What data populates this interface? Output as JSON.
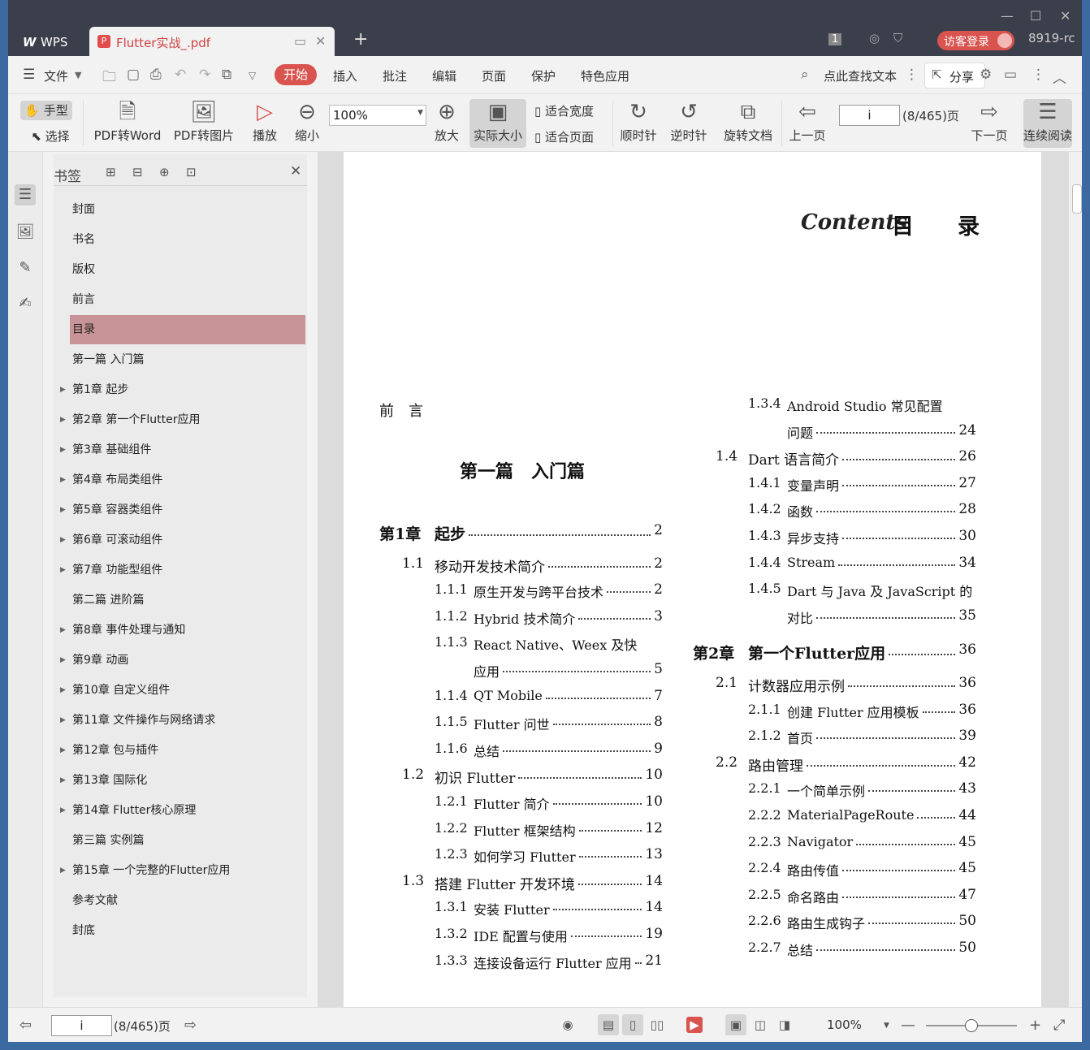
{
  "titlebar": {
    "app_tab": "WPS",
    "doc_tab": "Flutter实战_.pdf",
    "tab_count": "1",
    "login": "访客登录",
    "user_code": "8919-rc"
  },
  "menubar": {
    "file": "文件",
    "tabs": [
      "开始",
      "插入",
      "批注",
      "编辑",
      "页面",
      "保护",
      "特色应用"
    ],
    "search": "点此查找文本",
    "share": "分享"
  },
  "toolbar": {
    "hand": "手型",
    "select": "选择",
    "pdf2word": "PDF转Word",
    "pdf2img": "PDF转图片",
    "play": "播放",
    "zoom_out": "缩小",
    "zoom_value": "100%",
    "zoom_in": "放大",
    "actual_size": "实际大小",
    "fit_width": "适合宽度",
    "fit_page": "适合页面",
    "clockwise": "顺时针",
    "counter": "逆时针",
    "rotate": "旋转文档",
    "prev": "上一页",
    "page_value": "i",
    "page_total": "(8/465)页",
    "next": "下一页",
    "continuous": "连续阅读"
  },
  "bookmarks": {
    "title": "书签",
    "items": [
      {
        "label": "封面",
        "arrow": false
      },
      {
        "label": "书名",
        "arrow": false
      },
      {
        "label": "版权",
        "arrow": false
      },
      {
        "label": "前言",
        "arrow": false
      },
      {
        "label": "目录",
        "arrow": false,
        "active": true
      },
      {
        "label": "第一篇 入门篇",
        "arrow": false
      },
      {
        "label": "第1章 起步",
        "arrow": true
      },
      {
        "label": "第2章 第一个Flutter应用",
        "arrow": true
      },
      {
        "label": "第3章 基础组件",
        "arrow": true
      },
      {
        "label": "第4章 布局类组件",
        "arrow": true
      },
      {
        "label": "第5章 容器类组件",
        "arrow": true
      },
      {
        "label": "第6章 可滚动组件",
        "arrow": true
      },
      {
        "label": "第7章 功能型组件",
        "arrow": true
      },
      {
        "label": "第二篇 进阶篇",
        "arrow": false
      },
      {
        "label": "第8章 事件处理与通知",
        "arrow": true
      },
      {
        "label": "第9章 动画",
        "arrow": true
      },
      {
        "label": "第10章 自定义组件",
        "arrow": true
      },
      {
        "label": "第11章 文件操作与网络请求",
        "arrow": true
      },
      {
        "label": "第12章 包与插件",
        "arrow": true
      },
      {
        "label": "第13章 国际化",
        "arrow": true
      },
      {
        "label": "第14章 Flutter核心原理",
        "arrow": true
      },
      {
        "label": "第三篇 实例篇",
        "arrow": false
      },
      {
        "label": "第15章 一个完整的Flutter应用",
        "arrow": true
      },
      {
        "label": "参考文献",
        "arrow": false
      },
      {
        "label": "封底",
        "arrow": false
      }
    ]
  },
  "page": {
    "contents_script": "Contents",
    "contents_title": "目　　录",
    "preface": "前　言",
    "part1": "第一篇　入门篇",
    "left_col": [
      {
        "num": "第1章",
        "title": "起步",
        "page": "2",
        "level": 0
      },
      {
        "num": "1.1",
        "title": "移动开发技术简介",
        "page": "2",
        "level": 1
      },
      {
        "num": "1.1.1",
        "title": "原生开发与跨平台技术",
        "page": "2",
        "level": 2
      },
      {
        "num": "1.1.2",
        "title": "Hybrid 技术简介",
        "page": "3",
        "level": 2
      },
      {
        "num": "1.1.3",
        "title": "React Native、Weex 及快",
        "page": "",
        "level": 2
      },
      {
        "num": "",
        "title": "应用",
        "page": "5",
        "level": 2
      },
      {
        "num": "1.1.4",
        "title": "QT Mobile",
        "page": "7",
        "level": 2
      },
      {
        "num": "1.1.5",
        "title": "Flutter 问世",
        "page": "8",
        "level": 2
      },
      {
        "num": "1.1.6",
        "title": "总结",
        "page": "9",
        "level": 2
      },
      {
        "num": "1.2",
        "title": "初识 Flutter",
        "page": "10",
        "level": 1
      },
      {
        "num": "1.2.1",
        "title": "Flutter 简介",
        "page": "10",
        "level": 2
      },
      {
        "num": "1.2.2",
        "title": "Flutter 框架结构",
        "page": "12",
        "level": 2
      },
      {
        "num": "1.2.3",
        "title": "如何学习 Flutter",
        "page": "13",
        "level": 2
      },
      {
        "num": "1.3",
        "title": "搭建 Flutter 开发环境",
        "page": "14",
        "level": 1
      },
      {
        "num": "1.3.1",
        "title": "安装 Flutter",
        "page": "14",
        "level": 2
      },
      {
        "num": "1.3.2",
        "title": "IDE 配置与使用",
        "page": "19",
        "level": 2
      },
      {
        "num": "1.3.3",
        "title": "连接设备运行 Flutter 应用",
        "page": "21",
        "level": 2
      }
    ],
    "right_col": [
      {
        "num": "1.3.4",
        "title": "Android Studio 常见配置",
        "page": "",
        "level": 2
      },
      {
        "num": "",
        "title": "问题",
        "page": "24",
        "level": 2
      },
      {
        "num": "1.4",
        "title": "Dart 语言简介",
        "page": "26",
        "level": 1
      },
      {
        "num": "1.4.1",
        "title": "变量声明",
        "page": "27",
        "level": 2
      },
      {
        "num": "1.4.2",
        "title": "函数",
        "page": "28",
        "level": 2
      },
      {
        "num": "1.4.3",
        "title": "异步支持",
        "page": "30",
        "level": 2
      },
      {
        "num": "1.4.4",
        "title": "Stream",
        "page": "34",
        "level": 2
      },
      {
        "num": "1.4.5",
        "title": "Dart 与 Java 及 JavaScript 的",
        "page": "",
        "level": 2
      },
      {
        "num": "",
        "title": "对比",
        "page": "35",
        "level": 2
      },
      {
        "num": "第2章",
        "title": "第一个Flutter应用",
        "page": "36",
        "level": 0
      },
      {
        "num": "2.1",
        "title": "计数器应用示例",
        "page": "36",
        "level": 1
      },
      {
        "num": "2.1.1",
        "title": "创建 Flutter 应用模板",
        "page": "36",
        "level": 2
      },
      {
        "num": "2.1.2",
        "title": "首页",
        "page": "39",
        "level": 2
      },
      {
        "num": "2.2",
        "title": "路由管理",
        "page": "42",
        "level": 1
      },
      {
        "num": "2.2.1",
        "title": "一个简单示例",
        "page": "43",
        "level": 2
      },
      {
        "num": "2.2.2",
        "title": "MaterialPageRoute",
        "page": "44",
        "level": 2
      },
      {
        "num": "2.2.3",
        "title": "Navigator",
        "page": "45",
        "level": 2
      },
      {
        "num": "2.2.4",
        "title": "路由传值",
        "page": "45",
        "level": 2
      },
      {
        "num": "2.2.5",
        "title": "命名路由",
        "page": "47",
        "level": 2
      },
      {
        "num": "2.2.6",
        "title": "路由生成钩子",
        "page": "50",
        "level": 2
      },
      {
        "num": "2.2.7",
        "title": "总结",
        "page": "50",
        "level": 2
      }
    ]
  },
  "statusbar": {
    "page_value": "i",
    "page_total": "(8/465)页",
    "zoom": "100%"
  }
}
